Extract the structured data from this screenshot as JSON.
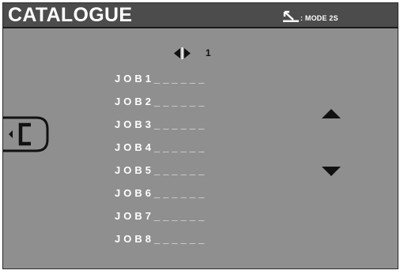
{
  "header": {
    "title": "CATALOGUE",
    "mode_icon": "return-arrow-icon",
    "mode_label": ": MODE 2S"
  },
  "pager": {
    "icon": "left-right-arrows-icon",
    "page": "1"
  },
  "jobs": [
    "JOB1______",
    "JOB2______",
    "JOB3______",
    "JOB4______",
    "JOB5______",
    "JOB6______",
    "JOB7______",
    "JOB8______"
  ],
  "controls": {
    "back_icon": "back-bracket-icon",
    "up_icon": "arrow-up-icon",
    "down_icon": "arrow-down-icon"
  },
  "colors": {
    "screen_bg": "#8f8f8f",
    "titlebar_bg": "#4c4c4c",
    "text": "#ffffff",
    "icons": "#111111"
  }
}
